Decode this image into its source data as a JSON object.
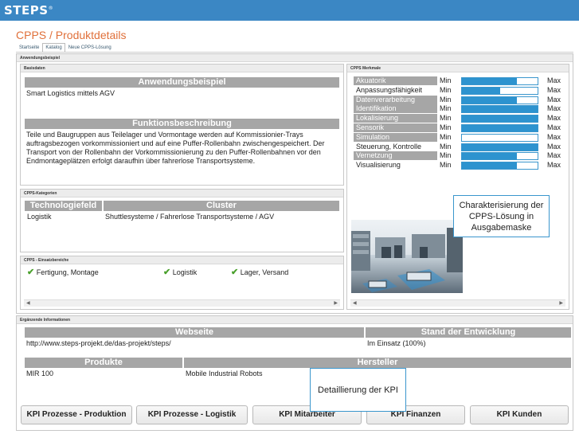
{
  "app": {
    "logo": "STEPS",
    "logo_tm": "®",
    "page_title": "CPPS / Produktdetails"
  },
  "tabs": [
    {
      "label": "Startseite"
    },
    {
      "label": "Katalog",
      "active": true
    },
    {
      "label": "Neue CPPS-Lösung"
    }
  ],
  "example": {
    "panel_title": "Anwendungsbeispiel",
    "basis": {
      "panel_title": "Basisdaten",
      "section1_head": "Anwendungsbeispiel",
      "section1_text": "Smart Logistics mittels AGV",
      "section2_head": "Funktionsbeschreibung",
      "section2_text": "Teile und Baugruppen aus Teilelager und Vormontage werden auf Kommissionier-Trays auftragsbezogen vorkommissioniert und auf eine Puffer-Rollenbahn zwischengespeichert. Der Transport von der Rollenbahn der Vorkommissionierung zu den Puffer-Rollenbahnen vor den Endmontageplätzen erfolgt daraufhin über fahrerlose Transportsysteme."
    },
    "kategorien": {
      "panel_title": "CPPS-Kategorien",
      "col1": "Technologiefeld",
      "col2": "Cluster",
      "val1": "Logistik",
      "val2": "Shuttlesysteme / Fahrerlose Transportsysteme / AGV"
    },
    "einsatz": {
      "panel_title": "CPPS - Einsatzbereiche",
      "items": [
        {
          "label": "Fertigung, Montage"
        },
        {
          "label": "Logistik"
        },
        {
          "label": "Lager, Versand"
        }
      ]
    },
    "merkmale": {
      "panel_title": "CPPS Merkmale",
      "min_label": "Min",
      "max_label": "Max",
      "items": [
        {
          "label": "Akuatorik",
          "value": 0.73,
          "highlight": true
        },
        {
          "label": "Anpassungsfähigkeit",
          "value": 0.5,
          "highlight": false
        },
        {
          "label": "Datenverarbeitung",
          "value": 0.73,
          "highlight": true
        },
        {
          "label": "Identifikation",
          "value": 1.0,
          "highlight": true
        },
        {
          "label": "Lokalisierung",
          "value": 1.0,
          "highlight": true
        },
        {
          "label": "Sensorik",
          "value": 1.0,
          "highlight": true
        },
        {
          "label": "Simulation",
          "value": 0.0,
          "highlight": true
        },
        {
          "label": "Steuerung, Kontrolle",
          "value": 1.0,
          "highlight": false
        },
        {
          "label": "Vernetzung",
          "value": 0.73,
          "highlight": true
        },
        {
          "label": "Visualisierung",
          "value": 0.73,
          "highlight": false
        }
      ]
    }
  },
  "callouts": {
    "characterization": "Charakterisierung der CPPS-Lösung in Ausgabemaske",
    "kpi": "Detaillierung der KPI"
  },
  "info": {
    "panel_title": "Ergänzende Informationen",
    "website_head": "Webseite",
    "stand_head": "Stand der Entwicklung",
    "website_value": "http://www.steps-projekt.de/das-projekt/steps/",
    "stand_value": "Im Einsatz (100%)",
    "produkte_head": "Produkte",
    "hersteller_head": "Hersteller",
    "produkte_value": "MIR 100",
    "hersteller_value": "Mobile Industrial Robots"
  },
  "buttons": [
    {
      "label": "KPI Prozesse - Produktion"
    },
    {
      "label": "KPI Prozesse - Logistik"
    },
    {
      "label": "KPI Mitarbeiter"
    },
    {
      "label": "KPI Finanzen"
    },
    {
      "label": "KPI Kunden"
    }
  ],
  "colors": {
    "topbar": "#3b87c4",
    "title": "#e0703a",
    "bar_fill": "#2d93cf",
    "section_head": "#a6a6a6"
  }
}
